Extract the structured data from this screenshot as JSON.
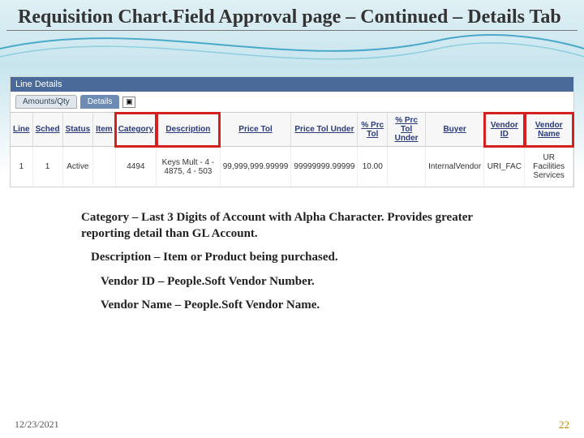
{
  "title": "Requisition Chart.Field Approval page – Continued – Details Tab",
  "screenshot": {
    "panel_title": "Line Details",
    "tabs": {
      "inactive": "Amounts/Qty",
      "active": "Details"
    },
    "columns": {
      "line": "Line",
      "sched": "Sched",
      "status": "Status",
      "item": "Item",
      "category": "Category",
      "description": "Description",
      "price_tol": "Price Tol",
      "price_tol_under": "Price Tol Under",
      "pct_prc_tol": "% Prc Tol",
      "pct_prc_tol_under": "% Prc Tol Under",
      "buyer": "Buyer",
      "vendor_id": "Vendor ID",
      "vendor_name": "Vendor Name"
    },
    "row": {
      "line": "1",
      "sched": "1",
      "status": "Active",
      "item": "",
      "category": "4494",
      "description": "Keys Mult - 4 - 4875, 4 - 503",
      "price_tol": "99,999,999.99999",
      "price_tol_under": "99999999.99999",
      "pct_prc_tol": "10.00",
      "pct_prc_tol_under": "",
      "buyer": "InternalVendor",
      "vendor_id": "URI_FAC",
      "vendor_name": "UR Facilities Services"
    }
  },
  "notes": {
    "n1": "Category – Last 3 Digits of Account with Alpha Character. Provides greater reporting detail than GL Account.",
    "n2": "Description – Item or Product being purchased.",
    "n3": "Vendor ID – People.Soft Vendor Number.",
    "n4": "Vendor Name – People.Soft Vendor Name."
  },
  "footer": {
    "date": "12/23/2021",
    "page": "22"
  }
}
